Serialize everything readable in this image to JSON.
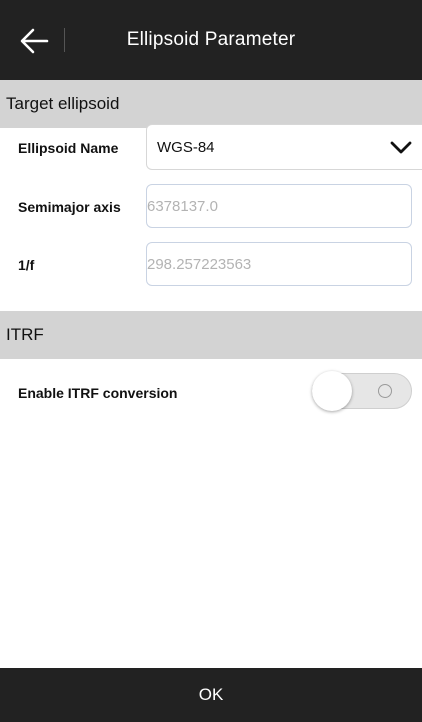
{
  "header": {
    "title": "Ellipsoid Parameter",
    "back_icon": "arrow-left-icon"
  },
  "target_section": {
    "title": "Target ellipsoid",
    "ellipsoid_name": {
      "label": "Ellipsoid Name",
      "value": "WGS-84",
      "icon": "chevron-down-icon"
    },
    "semimajor_axis": {
      "label": "Semimajor axis",
      "placeholder": "6378137.0"
    },
    "inverse_flattening": {
      "label": "1/f",
      "placeholder": "298.257223563"
    }
  },
  "itrf_section": {
    "title": "ITRF",
    "enable_conversion": {
      "label": "Enable ITRF conversion",
      "enabled": false
    }
  },
  "footer": {
    "ok_label": "OK"
  },
  "colors": {
    "bar_background": "#222222",
    "section_background": "#d3d3d3",
    "input_border": "#c9d3e3"
  }
}
